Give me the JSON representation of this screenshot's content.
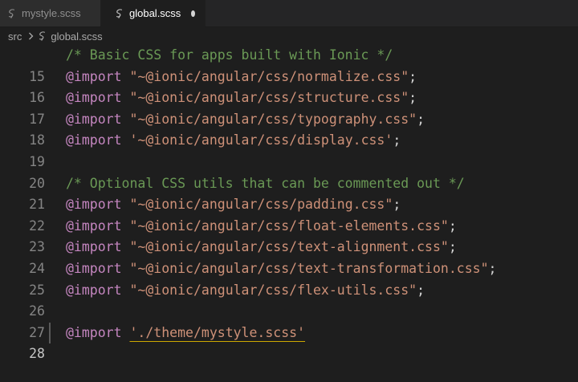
{
  "tabs": [
    {
      "label": "mystyle.scss",
      "active": false,
      "icon": "sass-file-icon"
    },
    {
      "label": "global.scss",
      "active": true,
      "dirty": true,
      "icon": "sass-file-icon"
    }
  ],
  "breadcrumb": {
    "folder": "src",
    "separator_icon": "chevron-right-icon",
    "file": "global.scss"
  },
  "colors": {
    "editor_bg": "#1e1e1e",
    "comment": "#6a9955",
    "keyword": "#c586c0",
    "string": "#ce9178",
    "line_number": "#858585"
  },
  "editor": {
    "lines": [
      {
        "number": "15",
        "comment": "/* Basic CSS for apps built with Ionic */"
      },
      {
        "number": "16",
        "keyword": "@import",
        "string": "\"~@ionic/angular/css/normalize.css\"",
        "punct": ";"
      },
      {
        "number": "17",
        "keyword": "@import",
        "string": "\"~@ionic/angular/css/structure.css\"",
        "punct": ";"
      },
      {
        "number": "18",
        "keyword": "@import",
        "string": "\"~@ionic/angular/css/typography.css\"",
        "punct": ";"
      },
      {
        "number": "19",
        "keyword": "@import",
        "string": "'~@ionic/angular/css/display.css'",
        "punct": ";"
      },
      {
        "number": "20"
      },
      {
        "number": "21",
        "comment": "/* Optional CSS utils that can be commented out */"
      },
      {
        "number": "22",
        "keyword": "@import",
        "string": "\"~@ionic/angular/css/padding.css\"",
        "punct": ";"
      },
      {
        "number": "23",
        "keyword": "@import",
        "string": "\"~@ionic/angular/css/float-elements.css\"",
        "punct": ";"
      },
      {
        "number": "24",
        "keyword": "@import",
        "string": "\"~@ionic/angular/css/text-alignment.css\"",
        "punct": ";"
      },
      {
        "number": "25",
        "keyword": "@import",
        "string": "\"~@ionic/angular/css/text-transformation.css\"",
        "punct": ";"
      },
      {
        "number": "26",
        "keyword": "@import",
        "string": "\"~@ionic/angular/css/flex-utils.css\"",
        "punct": ";"
      },
      {
        "number": "27"
      },
      {
        "number": "28",
        "keyword": "@import",
        "string": "'./theme/mystyle.scss'",
        "punct": "",
        "current": true
      }
    ]
  }
}
